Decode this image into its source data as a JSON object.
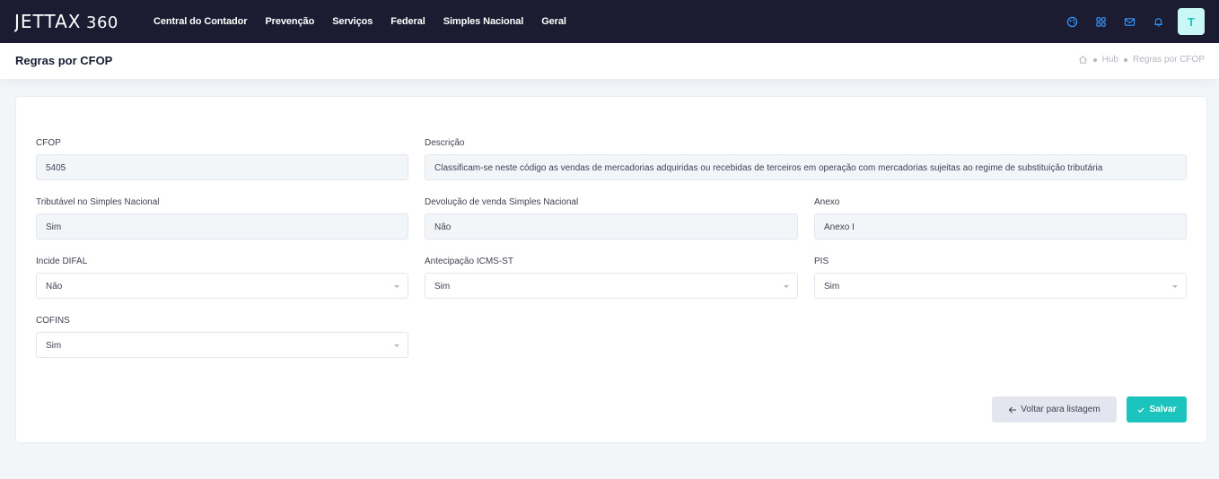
{
  "header": {
    "logo": "JETTAX 360",
    "nav": [
      "Central do Contador",
      "Prevenção",
      "Serviços",
      "Federal",
      "Simples Nacional",
      "Geral"
    ],
    "icons": [
      "palette-icon",
      "apps-grid-icon",
      "mail-icon",
      "bell-icon"
    ],
    "avatar_initial": "T"
  },
  "subheader": {
    "title": "Regras por CFOP",
    "breadcrumb": [
      "Hub",
      "Regras por CFOP"
    ]
  },
  "form": {
    "cfop": {
      "label": "CFOP",
      "value": "5405"
    },
    "descricao": {
      "label": "Descrição",
      "value": "Classificam-se neste código as vendas de mercadorias adquiridas ou recebidas de terceiros em operação com mercadorias sujeitas ao regime de substituição tributária"
    },
    "tributavel": {
      "label": "Tributável no Simples Nacional",
      "value": "Sim"
    },
    "devolucao": {
      "label": "Devolução de venda Simples Nacional",
      "value": "Não"
    },
    "anexo": {
      "label": "Anexo",
      "value": "Anexo I"
    },
    "difal": {
      "label": "Incide DIFAL",
      "value": "Não"
    },
    "antecipacao": {
      "label": "Antecipação ICMS-ST",
      "value": "Sim"
    },
    "pis": {
      "label": "PIS",
      "value": "Sim"
    },
    "cofins": {
      "label": "COFINS",
      "value": "Sim"
    }
  },
  "buttons": {
    "back": "Voltar para listagem",
    "save": "Salvar"
  },
  "colors": {
    "topbar": "#1b1c32",
    "accent": "#1bc5bd",
    "icon_blue": "#3699ff"
  }
}
